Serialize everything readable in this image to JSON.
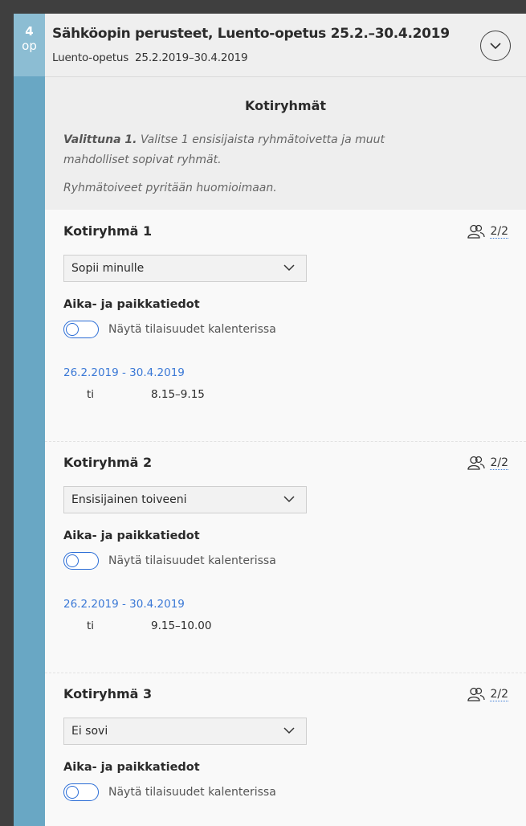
{
  "course": {
    "credits_number": "4",
    "credits_unit": "op",
    "title": "Sähköopin perusteet, Luento-opetus 25.2.–30.4.2019",
    "type": "Luento-opetus",
    "date_range": "25.2.2019–30.4.2019"
  },
  "intro": {
    "heading": "Kotiryhmät",
    "hint_bold": "Valittuna 1.",
    "hint_text": " Valitse 1 ensisijaista ryhmätoivetta ja muut mahdolliset sopivat ryhmät.",
    "hint2": "Ryhmätoiveet pyritään huomioimaan."
  },
  "groups": [
    {
      "title": "Kotiryhmä 1",
      "count": "2/2",
      "preference": "Sopii minulle",
      "time_heading": "Aika- ja paikkatiedot",
      "toggle_label": "Näytä tilaisuudet kalenterissa",
      "dates": "26.2.2019 - 30.4.2019",
      "day": "ti",
      "time": "8.15–9.15"
    },
    {
      "title": "Kotiryhmä 2",
      "count": "2/2",
      "preference": "Ensisijainen toiveeni",
      "time_heading": "Aika- ja paikkatiedot",
      "toggle_label": "Näytä tilaisuudet kalenterissa",
      "dates": "26.2.2019 - 30.4.2019",
      "day": "ti",
      "time": "9.15–10.00"
    },
    {
      "title": "Kotiryhmä 3",
      "count": "2/2",
      "preference": "Ei sovi",
      "time_heading": "Aika- ja paikkatiedot",
      "toggle_label": "Näytä tilaisuudet kalenterissa"
    }
  ],
  "icons": {
    "expand": "chevron-down-circle-icon",
    "group_size": "users-icon",
    "select": "chevron-down-icon"
  },
  "colors": {
    "accent_blue": "#2b6dd6",
    "strip": "#69a7c4",
    "credits_bg": "#8cbdd3",
    "date_link": "#3a78d6"
  }
}
